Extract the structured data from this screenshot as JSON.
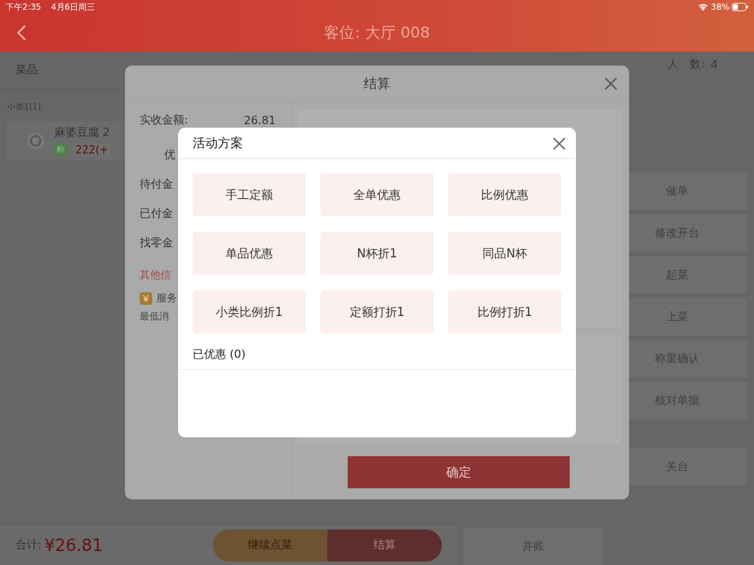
{
  "status_bar": {
    "time": "下午2:35",
    "date": "4月6日周三",
    "battery": "38%"
  },
  "header": {
    "title": "客位: 大厅 008"
  },
  "order": {
    "column_1": "菜品",
    "category": "小类1(1)",
    "items": [
      {
        "name": "麻婆豆腐 2",
        "badge": "称",
        "price": "222(+"
      }
    ]
  },
  "guests": {
    "label": "人　数:",
    "value": "4"
  },
  "actions": {
    "column_1": [
      "并账"
    ],
    "column_2_groups": [
      [
        "催单",
        "修改开台",
        "起菜",
        "上菜",
        "称重确认",
        "核对单据"
      ],
      [
        "关台"
      ]
    ]
  },
  "footer": {
    "total_label": "合计:",
    "total": "¥26.81",
    "buttons": [
      {
        "label": "继续点菜",
        "kind": "secondary"
      },
      {
        "label": "结算",
        "kind": "primary"
      }
    ]
  },
  "settle_dialog": {
    "title": "结算",
    "fields": [
      {
        "label": "实收金额:",
        "value": "26.81"
      },
      {
        "label": "优",
        "kind": "sub"
      },
      {
        "label": "待付金"
      },
      {
        "label": "已付金"
      },
      {
        "label": "找零金"
      }
    ],
    "other_info": "其他信",
    "service": "服务",
    "min_spend": "最低消",
    "confirm": "确定"
  },
  "promo_dialog": {
    "title": "活动方案",
    "options": [
      "手工定额",
      "全单优惠",
      "比例优惠",
      "单品优惠",
      "N杯折1",
      "同品N杯",
      "小类比例折1",
      "定额打折1",
      "比例打折1"
    ],
    "applied": "已优惠 (0)"
  }
}
